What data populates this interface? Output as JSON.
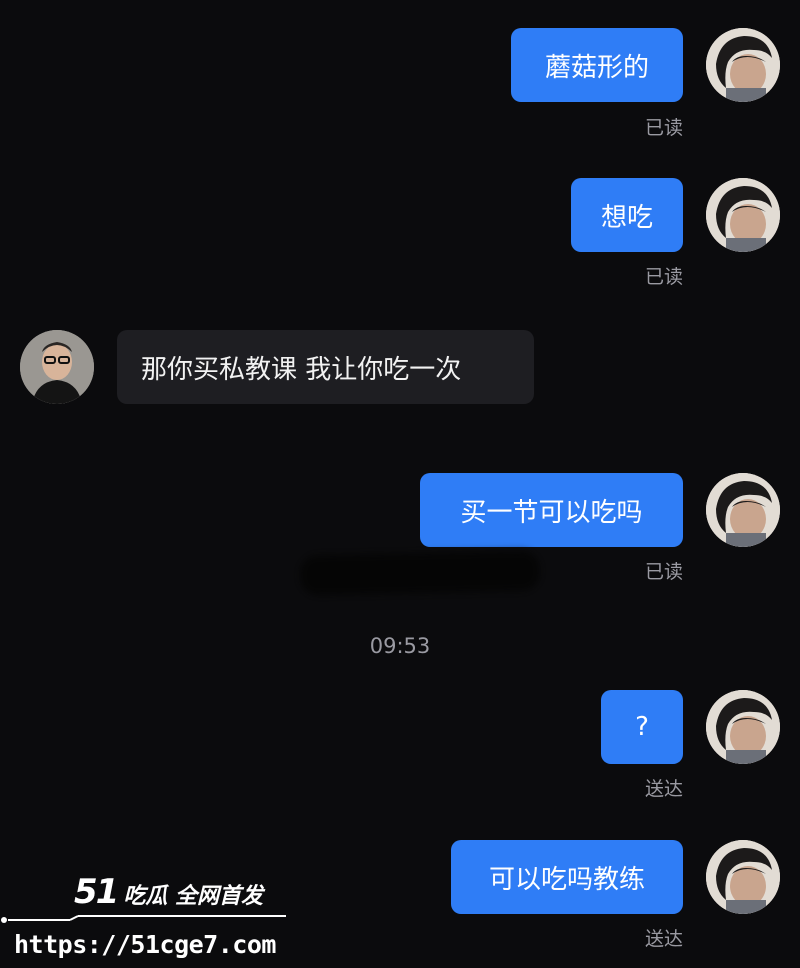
{
  "messages": [
    {
      "text": "蘑菇形的",
      "status": "已读"
    },
    {
      "text": "想吃",
      "status": "已读"
    },
    {
      "text": "那你买私教课 我让你吃一次"
    },
    {
      "text": "买一节可以吃吗",
      "status": "已读"
    },
    {
      "text": "?",
      "status": "送达"
    },
    {
      "text": "可以吃吗教练",
      "status": "送达"
    }
  ],
  "timestamp": "09:53",
  "watermark": {
    "brand_number": "51",
    "brand_text": "吃瓜 全网首发",
    "url": "https://51cge7.com"
  },
  "colors": {
    "background": "#0b0b0d",
    "outgoing_bubble": "#2f7df6",
    "incoming_bubble": "#1e1e22",
    "status_text": "#9a9aa2"
  }
}
